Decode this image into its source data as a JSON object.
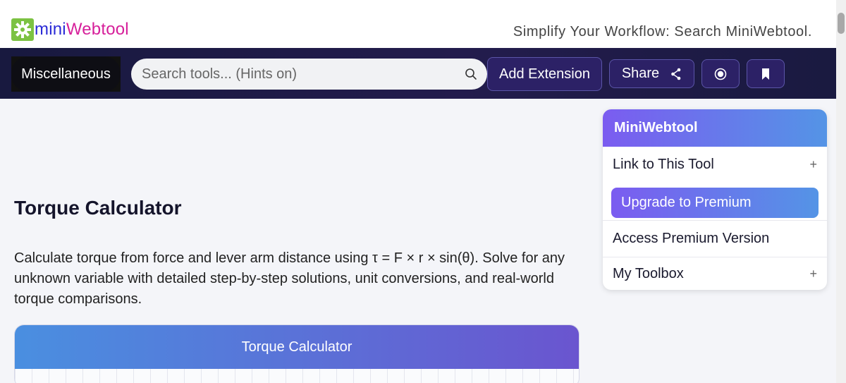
{
  "header": {
    "logo_mini": "mini",
    "logo_webtool": "Webtool",
    "tagline": "Simplify Your Workflow: Search MiniWebtool."
  },
  "nav": {
    "category": "Miscellaneous",
    "search_placeholder": "Search tools... (Hints on)",
    "add_extension": "Add Extension",
    "share": "Share"
  },
  "main": {
    "title": "Torque Calculator",
    "description": "Calculate torque from force and lever arm distance using τ = F × r × sin(θ). Solve for any unknown variable with detailed step-by-step solutions, unit conversions, and real-world torque comparisons.",
    "calc_header": "Torque Calculator"
  },
  "sidebar": {
    "title": "MiniWebtool",
    "link_to_tool": "Link to This Tool",
    "upgrade": "Upgrade to Premium",
    "access_premium": "Access Premium Version",
    "toolbox": "My Toolbox",
    "plus": "+"
  },
  "colors": {
    "logo_green": "#7cc242",
    "logo_blue": "#2b2bd6",
    "logo_pink": "#d61f9a",
    "nav_bg": "#1f1b4a",
    "accent_purple": "#7b5cf0",
    "accent_blue": "#5494e6"
  }
}
